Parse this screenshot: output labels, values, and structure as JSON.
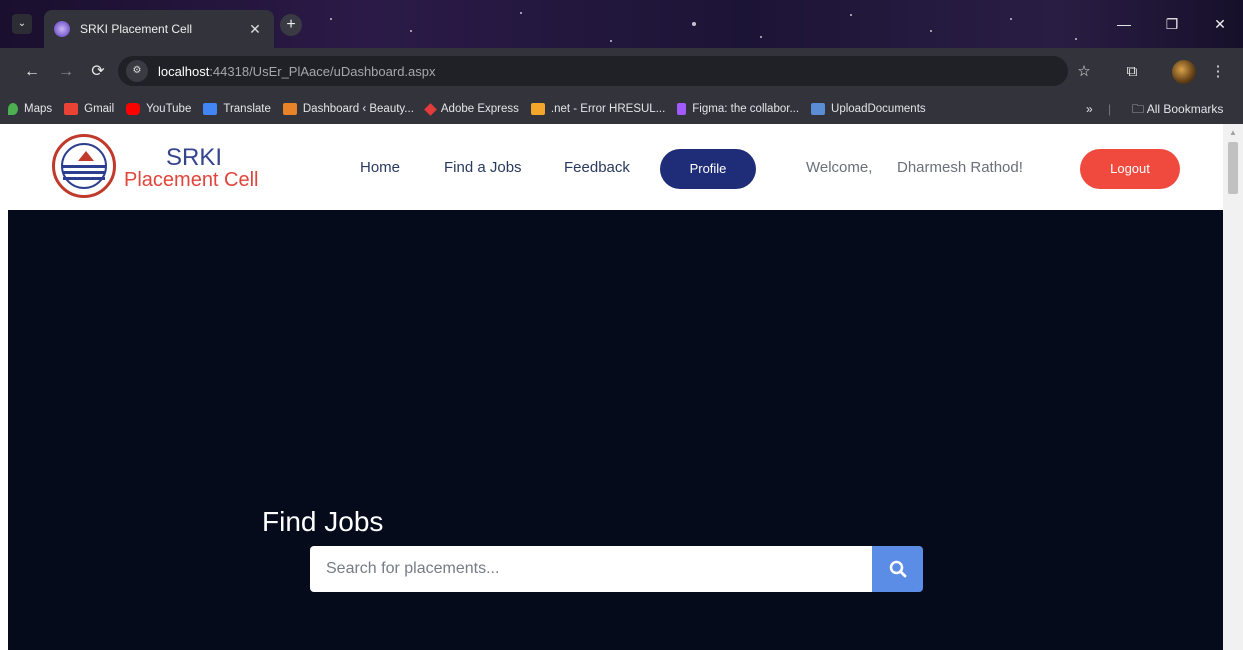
{
  "browser": {
    "tab": {
      "title": "SRKI Placement Cell"
    },
    "address": {
      "host": "localhost",
      "path": ":44318/UsEr_PlAace/uDashboard.aspx"
    },
    "bookmarks": [
      {
        "label": "Maps",
        "color": "#4caf50"
      },
      {
        "label": "Gmail",
        "color": "#ea4335"
      },
      {
        "label": "YouTube",
        "color": "#ff0000"
      },
      {
        "label": "Translate",
        "color": "#4285f4"
      },
      {
        "label": "Dashboard ‹ Beauty...",
        "color": "#e8832a"
      },
      {
        "label": "Adobe Express",
        "color": "#e23b3b"
      },
      {
        "label": ".net - Error HRESUL...",
        "color": "#f4a52c"
      },
      {
        "label": "Figma: the collabor...",
        "color": "#a259ff"
      },
      {
        "label": "UploadDocuments",
        "color": "#5a8dd6"
      }
    ],
    "all_bookmarks": "All Bookmarks"
  },
  "site": {
    "brand_top": "SRKI",
    "brand_bottom": "Placement Cell",
    "nav": {
      "home": "Home",
      "jobs": "Find a Jobs",
      "feedback": "Feedback"
    },
    "profile": "Profile",
    "welcome": "Welcome,",
    "username": "Dharmesh Rathod!",
    "logout": "Logout"
  },
  "hero": {
    "title": "Find Jobs",
    "search_placeholder": "Search for placements..."
  }
}
